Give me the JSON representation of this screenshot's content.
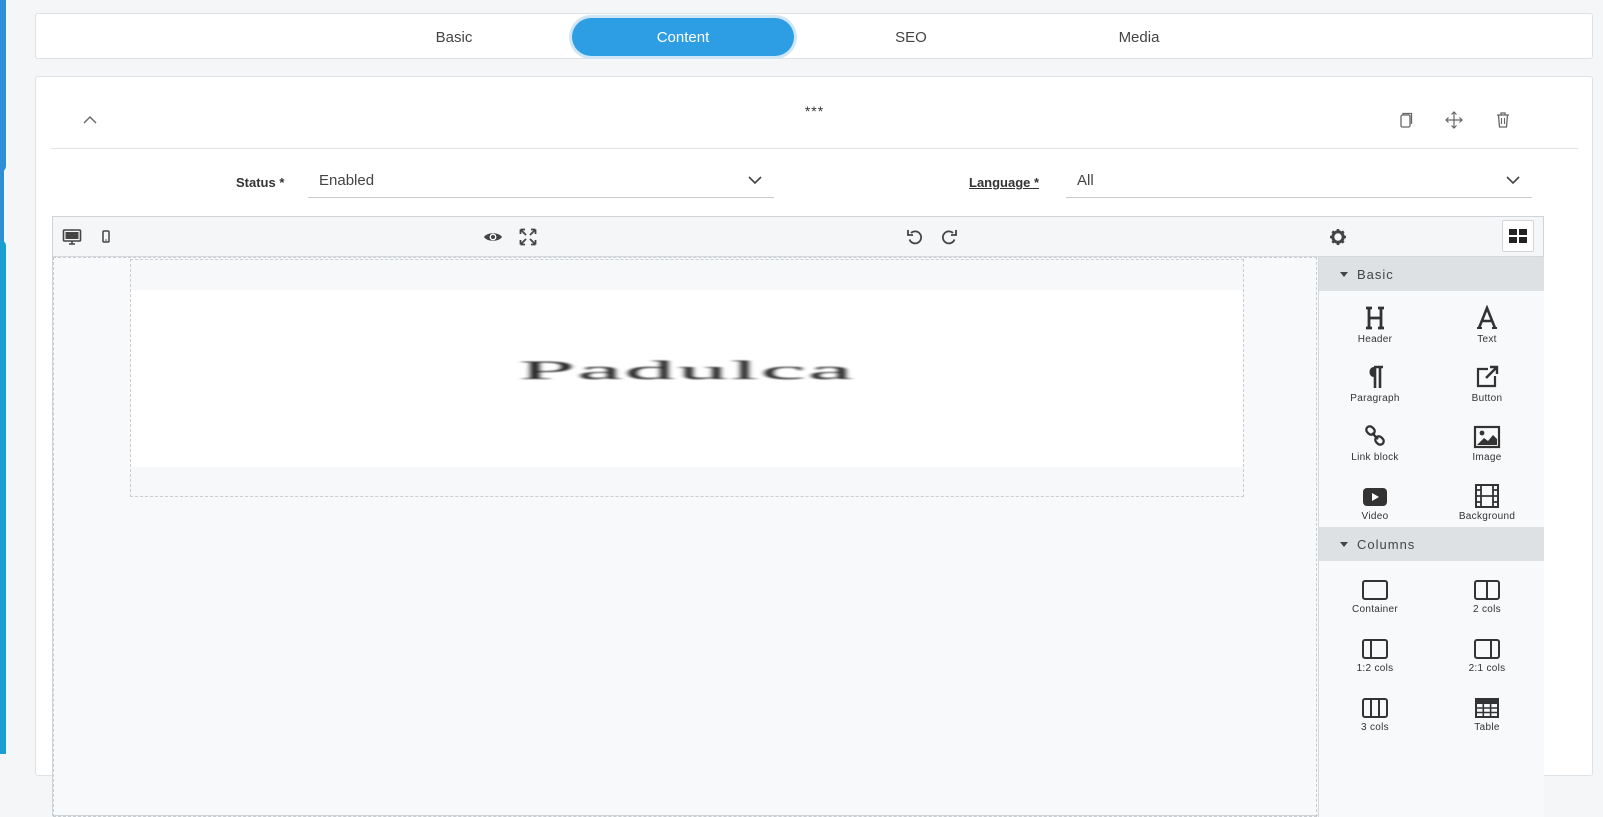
{
  "tabs": [
    {
      "label": "Basic",
      "active": false
    },
    {
      "label": "Content",
      "active": true
    },
    {
      "label": "SEO",
      "active": false
    },
    {
      "label": "Media",
      "active": false
    }
  ],
  "section": {
    "title": "***"
  },
  "fields": {
    "status": {
      "label": "Status *",
      "value": "Enabled"
    },
    "language": {
      "label": "Language *",
      "value": "All"
    }
  },
  "canvas": {
    "banner_text": "Padulca"
  },
  "blocks": {
    "basic": {
      "title": "Basic",
      "items": [
        {
          "label": "Header",
          "icon": "header-icon"
        },
        {
          "label": "Text",
          "icon": "text-icon"
        },
        {
          "label": "Paragraph",
          "icon": "paragraph-icon"
        },
        {
          "label": "Button",
          "icon": "external-link-icon"
        },
        {
          "label": "Link block",
          "icon": "link-icon"
        },
        {
          "label": "Image",
          "icon": "image-icon"
        },
        {
          "label": "Video",
          "icon": "video-icon"
        },
        {
          "label": "Background",
          "icon": "film-icon"
        }
      ]
    },
    "columns": {
      "title": "Columns",
      "items": [
        {
          "label": "Container",
          "icon": "container-icon"
        },
        {
          "label": "2 cols",
          "icon": "two-cols-icon"
        },
        {
          "label": "1:2 cols",
          "icon": "one-two-cols-icon"
        },
        {
          "label": "2:1 cols",
          "icon": "two-one-cols-icon"
        },
        {
          "label": "3 cols",
          "icon": "three-cols-icon"
        },
        {
          "label": "Table",
          "icon": "table-icon"
        }
      ]
    }
  },
  "colors": {
    "accent": "#2e9ee4",
    "category_bg": "#dde1e4"
  }
}
